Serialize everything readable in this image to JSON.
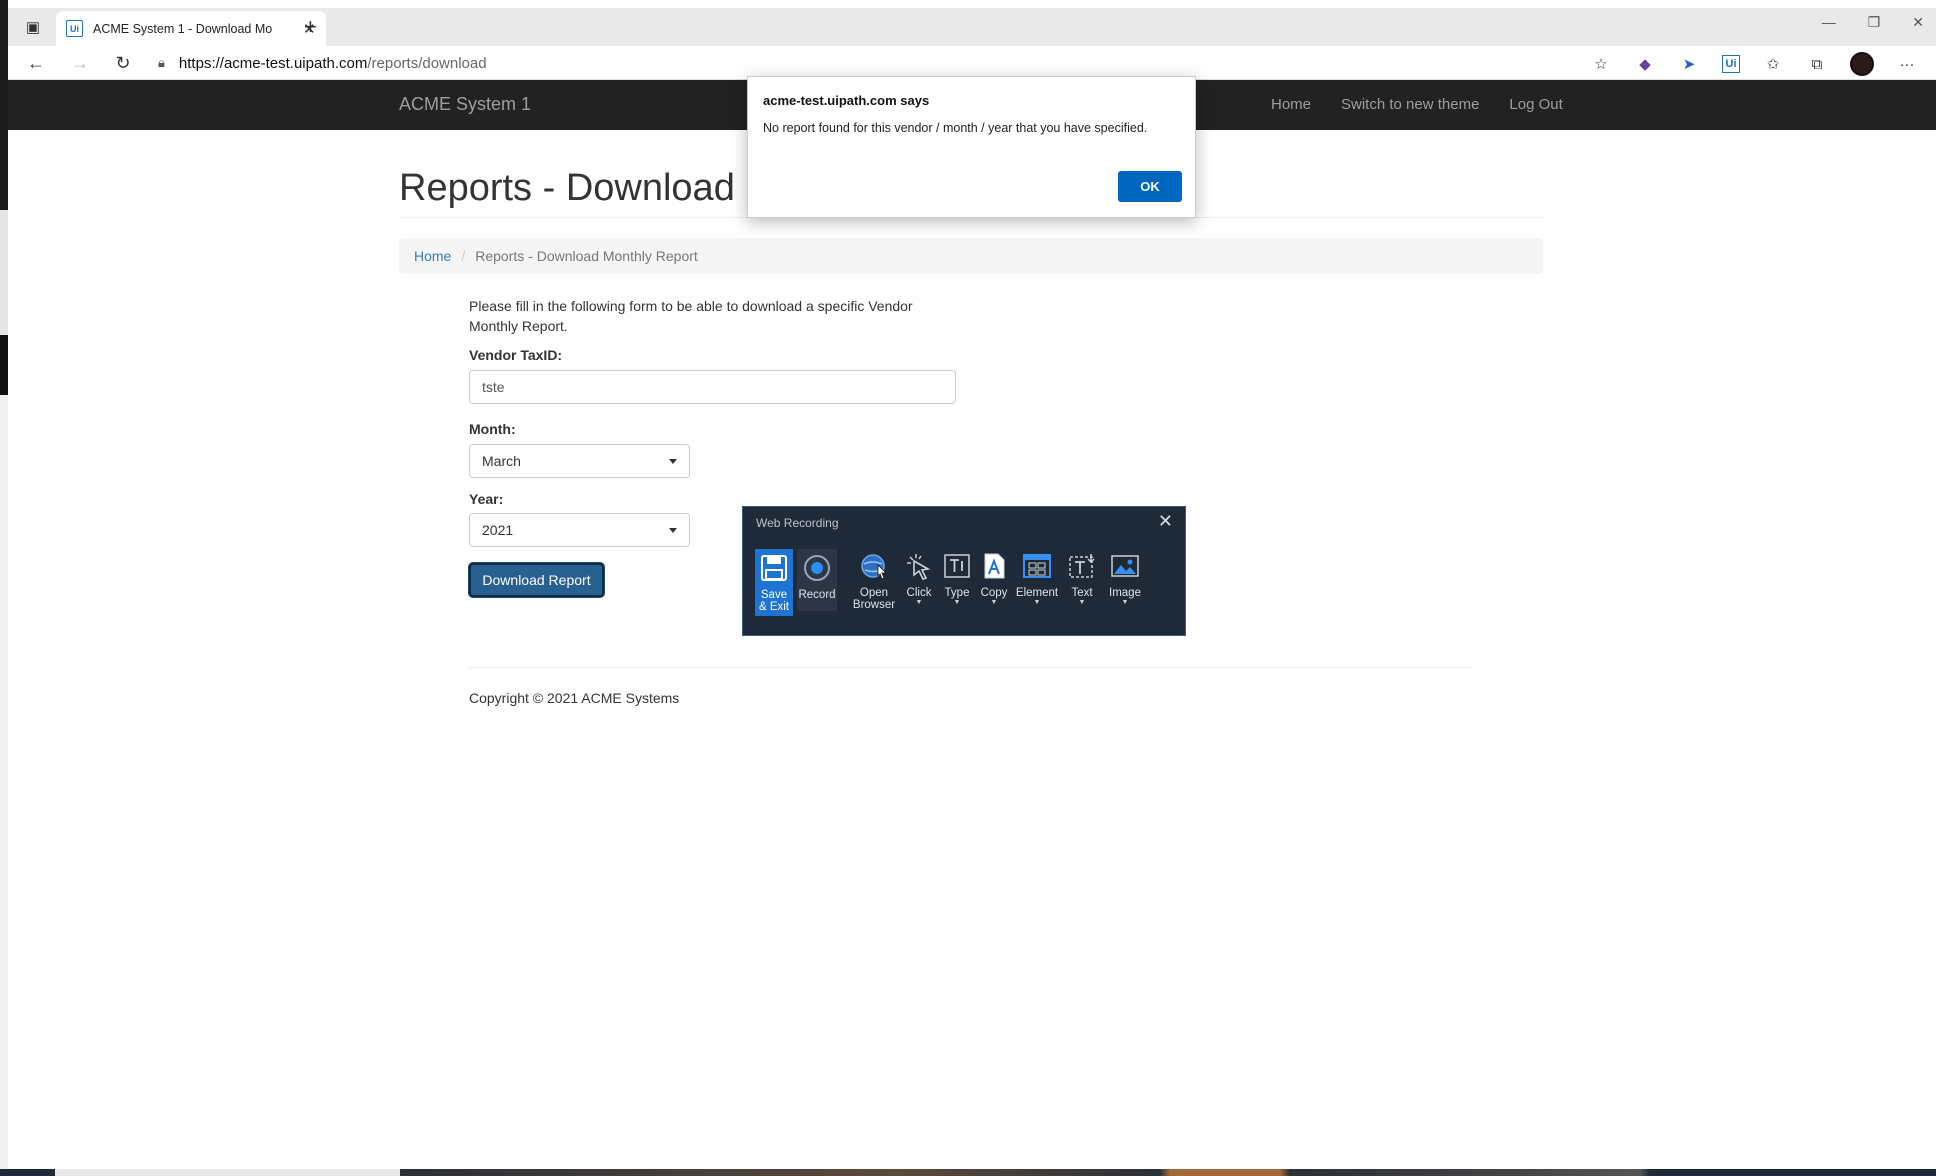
{
  "browser": {
    "tab_title": "ACME System 1 - Download Mo",
    "url_host": "https://acme-test.uipath.com",
    "url_path": "/reports/download",
    "favicon_text": "Ui"
  },
  "site": {
    "brand": "ACME System 1",
    "nav": [
      "Home",
      "Switch to new theme",
      "Log Out"
    ]
  },
  "page": {
    "title": "Reports - Download Monthly Report",
    "breadcrumb_home": "Home",
    "breadcrumb_sep": "/",
    "breadcrumb_current": "Reports - Download Monthly Report",
    "intro": "Please fill in the following form to be able to download a specific Vendor Monthly Report.",
    "vendor_label": "Vendor TaxID:",
    "vendor_value": "tste",
    "month_label": "Month:",
    "month_value": "March",
    "year_label": "Year:",
    "year_value": "2021",
    "download_button": "Download Report",
    "copyright": "Copyright © 2021 ACME Systems"
  },
  "alert": {
    "title": "acme-test.uipath.com says",
    "message": "No report found for this vendor / month / year that you have specified.",
    "ok": "OK"
  },
  "recorder": {
    "title": "Web Recording",
    "items": [
      {
        "label": "Save\n& Exit",
        "icon": "save-icon"
      },
      {
        "label": "Record",
        "icon": "record-icon"
      },
      {
        "label": "Open\nBrowser",
        "icon": "globe-icon"
      },
      {
        "label": "Click",
        "icon": "click-icon"
      },
      {
        "label": "Type",
        "icon": "type-icon"
      },
      {
        "label": "Copy",
        "icon": "copy-icon"
      },
      {
        "label": "Element",
        "icon": "element-icon"
      },
      {
        "label": "Text",
        "icon": "text-icon"
      },
      {
        "label": "Image",
        "icon": "image-icon"
      }
    ],
    "accent": "#1e74d2"
  }
}
